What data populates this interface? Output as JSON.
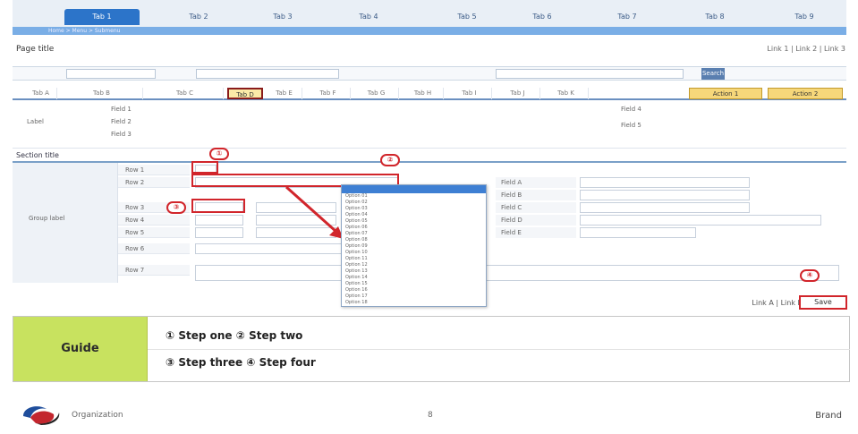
{
  "nav": {
    "tabs": [
      "Tab 1",
      "Tab 2",
      "Tab 3",
      "Tab 4",
      "Tab 5",
      "Tab 6",
      "Tab 7",
      "Tab 8",
      "Tab 9"
    ],
    "breadcrumb": "Home > Menu > Submenu"
  },
  "page": {
    "title": "Page title",
    "links": "Link 1 | Link 2 | Link 3"
  },
  "search": {
    "button_label": "Search"
  },
  "subtabs": {
    "items": [
      "Tab A",
      "Tab B",
      "Tab C",
      "Tab D",
      "Tab E",
      "Tab F",
      "Tab G",
      "Tab H",
      "Tab I",
      "Tab J",
      "Tab K"
    ],
    "action_buttons": [
      "Action 1",
      "Action 2"
    ]
  },
  "info": {
    "label": "Label",
    "fields": [
      "Field 1",
      "Field 2",
      "Field 3",
      "Field 4",
      "Field 5"
    ]
  },
  "form": {
    "section_title": "Section title",
    "group_label": "Group label",
    "row_labels": [
      "Row 1",
      "Row 2",
      "Row 3",
      "Row 4",
      "Row 5",
      "Row 6",
      "Row 7"
    ],
    "right_labels": [
      "Field A",
      "Field B",
      "Field C",
      "Field D",
      "Field E"
    ],
    "dropdown_options": [
      "Option 01",
      "Option 02",
      "Option 03",
      "Option 04",
      "Option 05",
      "Option 06",
      "Option 07",
      "Option 08",
      "Option 09",
      "Option 10",
      "Option 11",
      "Option 12",
      "Option 13",
      "Option 14",
      "Option 15",
      "Option 16",
      "Option 17",
      "Option 18"
    ]
  },
  "markers": {
    "m1": "①",
    "m2": "②",
    "m3": "③",
    "m4": "④"
  },
  "actions": {
    "footer_links": "Link A | Link B",
    "save_button": "Save"
  },
  "guide": {
    "badge": "Guide",
    "line1": "① Step one   ② Step two",
    "line2": "③ Step three   ④ Step four"
  },
  "footer": {
    "org": "Organization",
    "page_number": "8",
    "brand": "Brand"
  },
  "colors": {
    "accent": "#2c74c9",
    "highlight_red": "#d1252b",
    "guide_green": "#c8e25f"
  }
}
